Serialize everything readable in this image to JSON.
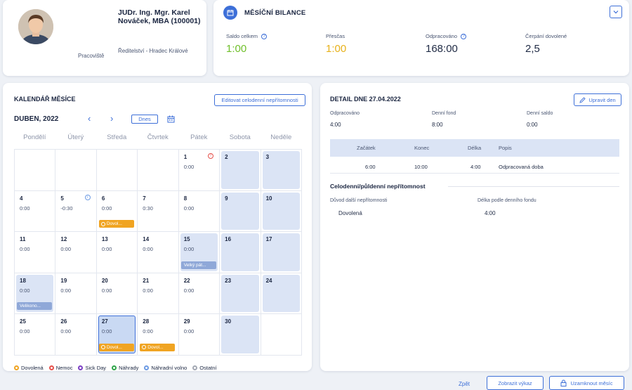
{
  "profile": {
    "name": "JUDr. Ing. Mgr. Karel Nováček, MBA (100001)",
    "workplace_label": "Pracoviště",
    "workplace_value": "Ředitelství - Hradec Králové"
  },
  "balance": {
    "title": "MĚSÍČNÍ BILANCE",
    "stats": [
      {
        "label": "Saldo celkem",
        "value": "1:00",
        "color": "#6fbf2a"
      },
      {
        "label": "Přesčas",
        "value": "1:00",
        "color": "#e7b11a"
      },
      {
        "label": "Odpracováno",
        "value": "168:00",
        "color": "#1f2a44"
      },
      {
        "label": "Čerpání dovolené",
        "value": "2,5",
        "color": "#1f2a44"
      }
    ]
  },
  "calendar": {
    "title": "KALENDÁŘ MĚSÍCE",
    "edit_button": "Editovat celodenní nepřítomnosti",
    "month_label": "DUBEN, 2022",
    "today_button": "Dnes",
    "weekdays": [
      "Pondělí",
      "Úterý",
      "Středa",
      "Čtvrtek",
      "Pátek",
      "Sobota",
      "Neděle"
    ],
    "days": [
      {
        "d": "",
        "v": ""
      },
      {
        "d": "",
        "v": ""
      },
      {
        "d": "",
        "v": ""
      },
      {
        "d": "",
        "v": ""
      },
      {
        "d": "1",
        "v": "0:00",
        "info": "red"
      },
      {
        "d": "2",
        "v": "",
        "weekend": true
      },
      {
        "d": "3",
        "v": "",
        "weekend": true
      },
      {
        "d": "4",
        "v": "0:00"
      },
      {
        "d": "5",
        "v": "-0:30",
        "info": "blue"
      },
      {
        "d": "6",
        "v": "0:00",
        "tag": "Dovol...",
        "tagc": "orange"
      },
      {
        "d": "7",
        "v": "0:30"
      },
      {
        "d": "8",
        "v": "0:00"
      },
      {
        "d": "9",
        "v": "",
        "weekend": true
      },
      {
        "d": "10",
        "v": "",
        "weekend": true
      },
      {
        "d": "11",
        "v": "0:00"
      },
      {
        "d": "12",
        "v": "0:00"
      },
      {
        "d": "13",
        "v": "0:00"
      },
      {
        "d": "14",
        "v": "0:00"
      },
      {
        "d": "15",
        "v": "0:00",
        "holiday": true,
        "tag": "Velký pát...",
        "tagc": "blue"
      },
      {
        "d": "16",
        "v": "",
        "weekend": true
      },
      {
        "d": "17",
        "v": "",
        "weekend": true
      },
      {
        "d": "18",
        "v": "0:00",
        "holiday": true,
        "tag": "Velikono...",
        "tagc": "blue"
      },
      {
        "d": "19",
        "v": "0:00"
      },
      {
        "d": "20",
        "v": "0:00"
      },
      {
        "d": "21",
        "v": "0:00"
      },
      {
        "d": "22",
        "v": "0:00"
      },
      {
        "d": "23",
        "v": "",
        "weekend": true
      },
      {
        "d": "24",
        "v": "",
        "weekend": true
      },
      {
        "d": "25",
        "v": "0:00"
      },
      {
        "d": "26",
        "v": "0:00"
      },
      {
        "d": "27",
        "v": "0:00",
        "selected": true,
        "tag": "Dovol...",
        "tagc": "orange"
      },
      {
        "d": "28",
        "v": "0:00",
        "tag": "Dovol...",
        "tagc": "orange"
      },
      {
        "d": "29",
        "v": "0:00"
      },
      {
        "d": "30",
        "v": "",
        "weekend": true
      },
      {
        "d": "",
        "v": ""
      }
    ],
    "legend": [
      {
        "label": "Dovolená",
        "color": "#f0a422"
      },
      {
        "label": "Nemoc",
        "color": "#e5504a"
      },
      {
        "label": "Sick Day",
        "color": "#7b3fc4"
      },
      {
        "label": "Náhrady",
        "color": "#2fa54a"
      },
      {
        "label": "Náhradní volno",
        "color": "#6d9be3"
      },
      {
        "label": "Ostatní",
        "color": "#a3a8b3"
      }
    ]
  },
  "detail": {
    "title": "DETAIL DNE 27.04.2022",
    "edit_button": "Upravit den",
    "stats": [
      {
        "label": "Odpracováno",
        "value": "4:00"
      },
      {
        "label": "Denní fond",
        "value": "8:00"
      },
      {
        "label": "Denní saldo",
        "value": "0:00"
      }
    ],
    "table_headers": [
      "Začátek",
      "Konec",
      "Délka",
      "Popis"
    ],
    "table_row": [
      "6:00",
      "10:00",
      "4:00",
      "Odpracovaná doba"
    ],
    "absence_title": "Celodenní/půldenní nepřítomnost",
    "absence_reason_label": "Důvod další nepřítomnosti",
    "absence_length_label": "Délka podle denního fondu",
    "absence_reason_value": "Dovolená",
    "absence_length_value": "4:00"
  },
  "footer": {
    "back": "Zpět",
    "show_report": "Zobrazit výkaz",
    "lock_month": "Uzamknout měsíc"
  }
}
